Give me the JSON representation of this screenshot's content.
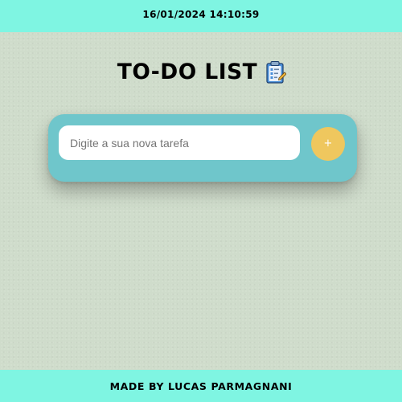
{
  "header": {
    "datetime": "16/01/2024 14:10:59"
  },
  "app": {
    "title": "TO-DO LIST",
    "title_icon": "clipboard-icon"
  },
  "task_form": {
    "input_placeholder": "Digite a sua nova tarefa",
    "input_value": "",
    "add_label": "+"
  },
  "footer": {
    "credits": "MADE BY LUCAS PARMAGNANI"
  },
  "colors": {
    "bars": "#7ff5e2",
    "background": "#cfdccb",
    "panel": "#6fc6cb",
    "add_button": "#efc75e"
  }
}
